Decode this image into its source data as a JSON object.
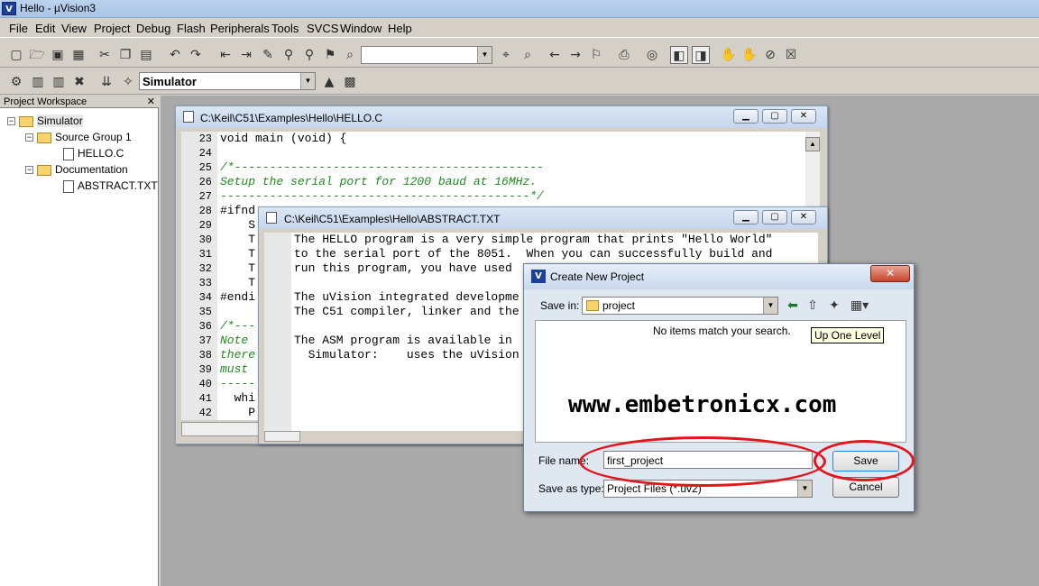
{
  "app": {
    "title": "Hello - µVision3",
    "icon_text": "V"
  },
  "menu": [
    "File",
    "Edit",
    "View",
    "Project",
    "Debug",
    "Flash",
    "Peripherals",
    "Tools",
    "SVCS",
    "Window",
    "Help"
  ],
  "toolbar": {
    "target": "Simulator"
  },
  "workspace": {
    "title": "Project Workspace",
    "tree": {
      "root": "Simulator",
      "group1": "Source Group 1",
      "file1": "HELLO.C",
      "group2": "Documentation",
      "file2": "ABSTRACT.TXT"
    }
  },
  "editor1": {
    "title": "C:\\Keil\\C51\\Examples\\Hello\\HELLO.C",
    "lines": [
      "23",
      "24",
      "25",
      "26",
      "27",
      "28",
      "29",
      "30",
      "31",
      "32",
      "33",
      "34",
      "35",
      "36",
      "37",
      "38",
      "39",
      "40",
      "41",
      "42"
    ],
    "code": [
      {
        "t": "void main (void) {",
        "c": ""
      },
      {
        "t": "",
        "c": ""
      },
      {
        "t": "/*--------------------------------------------",
        "c": "green"
      },
      {
        "t": "Setup the serial port for 1200 baud at 16MHz.",
        "c": "green"
      },
      {
        "t": "--------------------------------------------*/",
        "c": "green"
      },
      {
        "t": "#ifnd",
        "c": ""
      },
      {
        "t": "    S",
        "c": ""
      },
      {
        "t": "    T",
        "c": ""
      },
      {
        "t": "    T",
        "c": ""
      },
      {
        "t": "    T",
        "c": ""
      },
      {
        "t": "    T",
        "c": ""
      },
      {
        "t": "#endi",
        "c": ""
      },
      {
        "t": "",
        "c": ""
      },
      {
        "t": "/*---",
        "c": "green"
      },
      {
        "t": "Note ",
        "c": "green"
      },
      {
        "t": "there",
        "c": "green"
      },
      {
        "t": "must ",
        "c": "green"
      },
      {
        "t": "-----",
        "c": "green"
      },
      {
        "t": "  whi",
        "c": ""
      },
      {
        "t": "    P",
        "c": ""
      }
    ]
  },
  "editor2": {
    "title": "C:\\Keil\\C51\\Examples\\Hello\\ABSTRACT.TXT",
    "code": [
      "The HELLO program is a very simple program that prints \"Hello World\"",
      "to the serial port of the 8051.  When you can successfully build and",
      "run this program, you have used",
      "",
      "The uVision integrated developme",
      "The C51 compiler, linker and the",
      "",
      "The ASM program is available in ",
      "  Simulator:    uses the uVision"
    ]
  },
  "dialog": {
    "title": "Create New Project",
    "save_in_label": "Save in:",
    "save_in_value": "project",
    "empty_message": "No items match your search.",
    "tooltip": "Up One Level",
    "watermark": "www.embetronicx.com",
    "file_name_label": "File name:",
    "file_name_value": "first_project",
    "save_as_label": "Save as type:",
    "save_as_value": "Project Files (*.uv2)",
    "save_label": "Save",
    "cancel_label": "Cancel"
  }
}
